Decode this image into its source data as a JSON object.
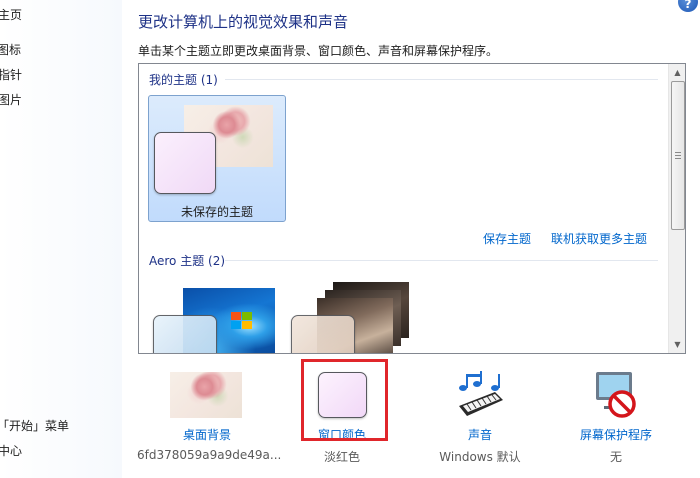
{
  "leftnav": {
    "items": [
      "主页",
      "图标",
      "指针",
      "图片",
      "「开始」菜单",
      "中心"
    ],
    "visible_text": [
      "主页",
      "图标",
      "指针",
      "图片",
      "「开始」菜单",
      "中心"
    ]
  },
  "help_icon": "?",
  "header": {
    "title": "更改计算机上的视觉效果和声音",
    "subtitle": "单击某个主题立即更改桌面背景、窗口颜色、声音和屏幕保护程序。"
  },
  "themes": {
    "my_group": {
      "label": "我的主题 (1)"
    },
    "my_items": [
      {
        "name": "未保存的主题"
      }
    ],
    "links": {
      "save": "保存主题",
      "more_online": "联机获取更多主题"
    },
    "aero_group": {
      "label": "Aero 主题 (2)"
    }
  },
  "bottom": {
    "desktop_background": {
      "label": "桌面背景",
      "value": "6fd378059a9a9de49a..."
    },
    "window_color": {
      "label": "窗口颜色",
      "value": "淡红色"
    },
    "sounds": {
      "label": "声音",
      "value": "Windows 默认"
    },
    "screen_saver": {
      "label": "屏幕保护程序",
      "value": "无"
    }
  },
  "colors": {
    "accent_link": "#0066cc",
    "title": "#1e3287",
    "highlight_border": "#e0262b",
    "window_color_swatch": "#f8e6fa"
  },
  "icons": [
    "help-icon",
    "music-keyboard-icon",
    "no-screensaver-icon",
    "windows-logo-icon"
  ]
}
